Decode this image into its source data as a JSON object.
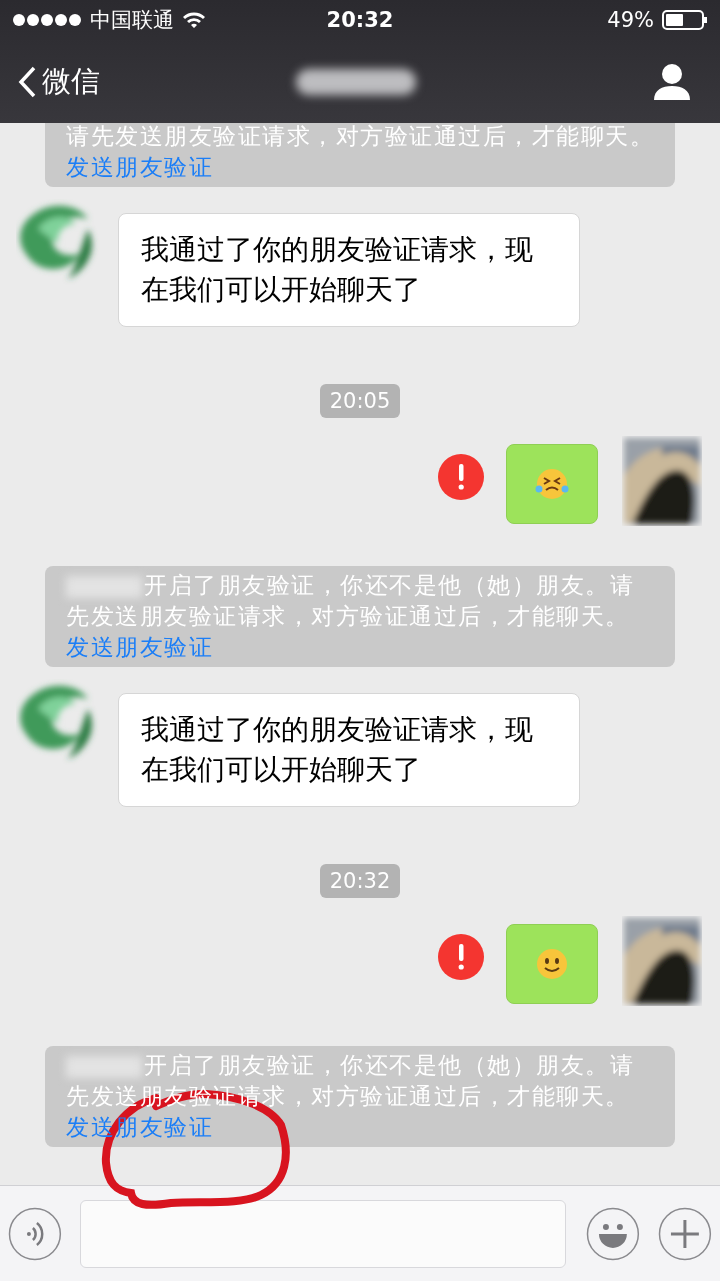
{
  "status_bar": {
    "carrier": "中国联通",
    "time": "20:32",
    "battery": "49%"
  },
  "nav": {
    "back": "微信"
  },
  "messages": [
    {
      "kind": "system",
      "text": "请先发送朋友验证请求，对方验证通过后，才能聊天。",
      "link": "发送朋友验证",
      "name_hidden": false
    },
    {
      "kind": "received",
      "text": "我通过了你的朋友验证请求，现在我们可以开始聊天了"
    },
    {
      "kind": "time",
      "text": "20:05"
    },
    {
      "kind": "tearsemoji",
      "failed": true
    },
    {
      "kind": "system",
      "text": "开启了朋友验证，你还不是他（她）朋友。请先发送朋友验证请求，对方验证通过后，才能聊天。",
      "link": "发送朋友验证",
      "name_hidden": true
    },
    {
      "kind": "received",
      "text": "我通过了你的朋友验证请求，现在我们可以开始聊天了"
    },
    {
      "kind": "time",
      "text": "20:32"
    },
    {
      "kind": "smileemoji",
      "failed": true
    },
    {
      "kind": "system",
      "text": "开启了朋友验证，你还不是他（她）朋友。请先发送朋友验证请求，对方验证通过后，才能聊天。",
      "link": "发送朋友验证",
      "name_hidden": true
    }
  ]
}
